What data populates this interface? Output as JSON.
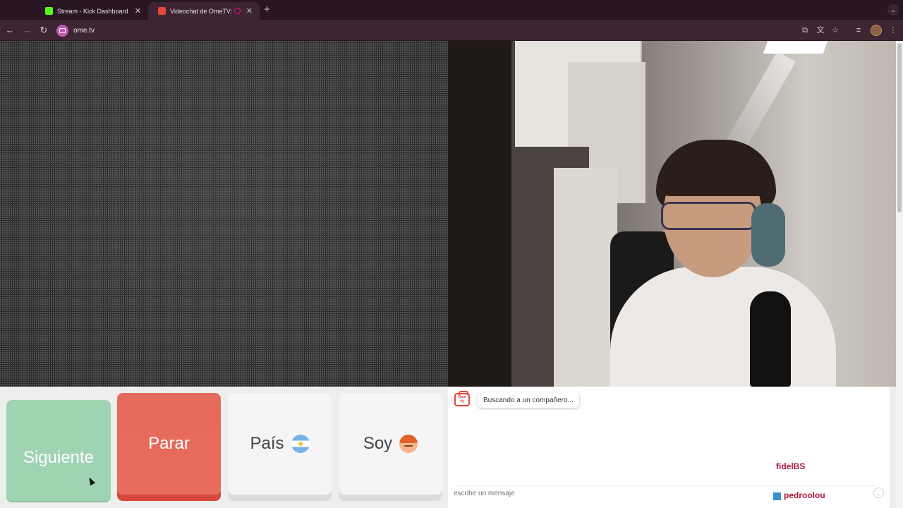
{
  "browser": {
    "tabs": [
      {
        "title": "Stream - Kick Dashboard",
        "favicon_color": "#53fc18",
        "active": false
      },
      {
        "title": "Videochat de OmeTV: alte",
        "favicon_color": "#e2473a",
        "active": true
      }
    ],
    "new_tab_label": "+",
    "url": "ome.tv"
  },
  "controls": {
    "next_label": "Siguiente",
    "stop_label": "Parar",
    "country_label": "País",
    "me_label": "Soy"
  },
  "chat": {
    "logo_text": "Ome TV",
    "status_message": "Buscando a un compañero...",
    "input_placeholder": "escribe un mensaje"
  },
  "stream_overlay": [
    {
      "name": "fidelBS",
      "name_color": "#b0183c"
    },
    {
      "name": "pedroolou",
      "name_color": "#b0183c"
    }
  ],
  "colors": {
    "next": "#9fd4b2",
    "stop": "#e86c5e",
    "accent": "#e2473a"
  }
}
